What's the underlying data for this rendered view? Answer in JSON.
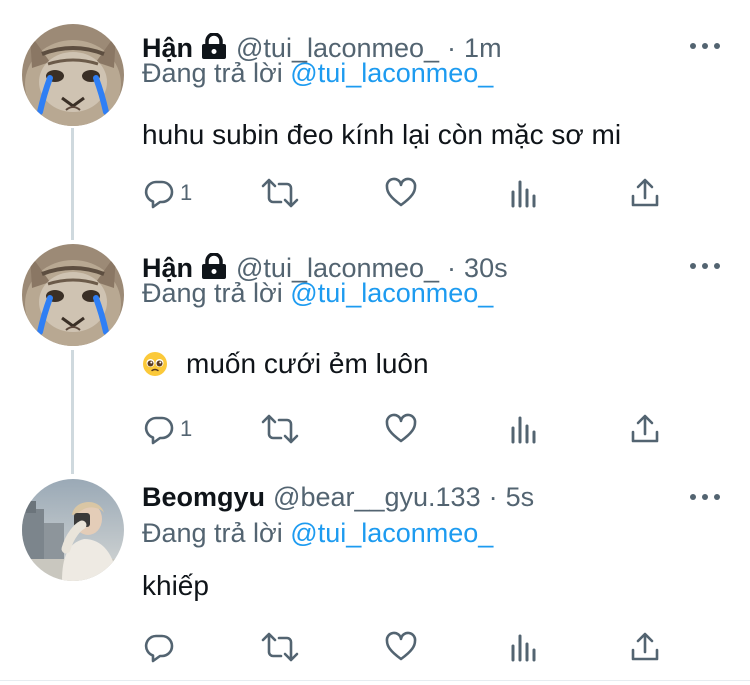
{
  "tweets": [
    {
      "name": "Hận",
      "handle": "@tui_laconmeo_",
      "time": "1m",
      "reply_prefix": "Đang trả lời",
      "reply_mention": "@tui_laconmeo_",
      "text": "huhu subin đeo kính lại còn mặc sơ mi",
      "reply_count": "1",
      "locked": true
    },
    {
      "name": "Hận",
      "handle": "@tui_laconmeo_",
      "time": "30s",
      "reply_prefix": "Đang trả lời",
      "reply_mention": "@tui_laconmeo_",
      "text": "muốn cưới ẻm luôn",
      "emoji": "pleading-face",
      "reply_count": "1",
      "locked": true
    },
    {
      "name": "Beomgyu",
      "handle": "@bear__gyu.133",
      "time": "5s",
      "reply_prefix": "Đang trả lời",
      "reply_mention": "@tui_laconmeo_",
      "text": "khiếp",
      "reply_count": "",
      "locked": false
    }
  ],
  "separator": "·",
  "colors": {
    "text": "#0f1419",
    "secondary": "#536471",
    "link": "#1d9bf0",
    "thread_line": "#cfd9de"
  },
  "icons": [
    "lock-icon",
    "more-icon",
    "reply-icon",
    "retweet-icon",
    "like-icon",
    "analytics-icon",
    "share-icon"
  ]
}
